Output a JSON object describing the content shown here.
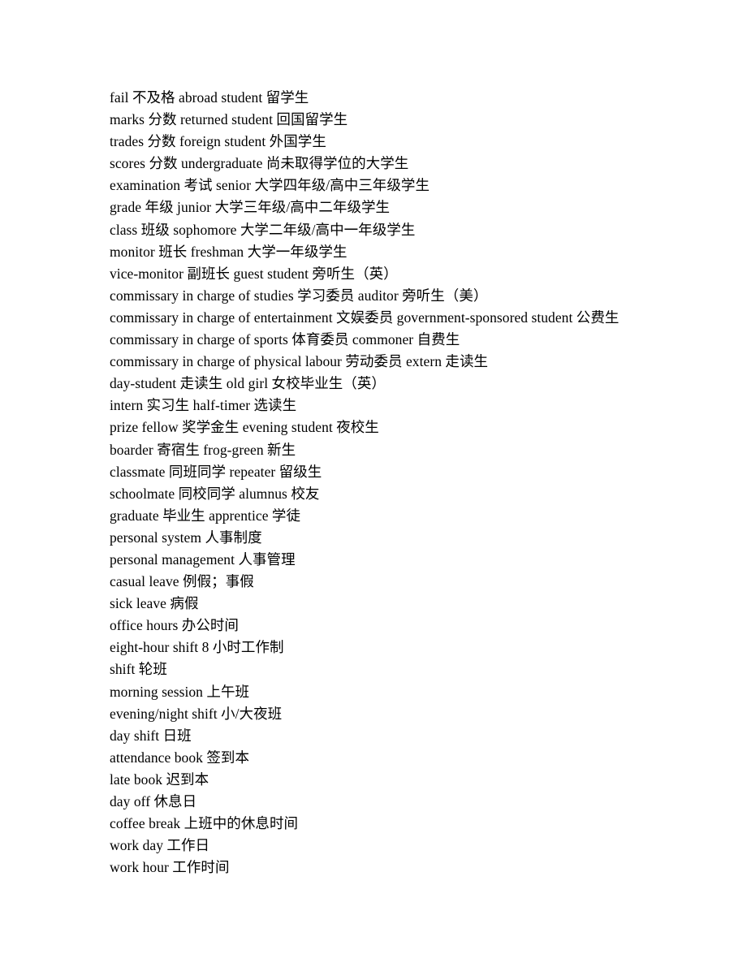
{
  "document": {
    "page_background": "#ffffff",
    "text_color": "#000000",
    "lines": [
      "fail 不及格 abroad student 留学生",
      "marks 分数 returned student 回国留学生",
      "trades 分数 foreign student 外国学生",
      "scores 分数 undergraduate 尚未取得学位的大学生",
      "examination 考试 senior 大学四年级/高中三年级学生",
      "grade 年级 junior 大学三年级/高中二年级学生",
      "class 班级 sophomore 大学二年级/高中一年级学生",
      "monitor 班长 freshman 大学一年级学生",
      "vice-monitor 副班长 guest student 旁听生（英）",
      "commissary in charge of studies 学习委员 auditor 旁听生（美）",
      "commissary in charge of entertainment 文娱委员 government-sponsored student 公费生",
      "commissary in charge of sports 体育委员 commoner 自费生",
      "commissary in charge of physical labour 劳动委员 extern 走读生",
      "day-student 走读生 old girl 女校毕业生（英）",
      "intern 实习生 half-timer 选读生",
      "prize fellow 奖学金生 evening student 夜校生",
      "boarder 寄宿生 frog-green 新生",
      "classmate 同班同学 repeater 留级生",
      "schoolmate 同校同学 alumnus 校友",
      "graduate 毕业生 apprentice 学徒",
      "personal system 人事制度",
      "personal management 人事管理",
      "casual leave 例假；事假",
      "sick leave 病假",
      "office hours 办公时间",
      "eight-hour shift 8 小时工作制",
      "shift 轮班",
      "morning session 上午班",
      "evening/night shift 小/大夜班",
      "day shift 日班",
      "attendance book 签到本",
      "late book 迟到本",
      "day off 休息日",
      "coffee break 上班中的休息时间",
      "work day 工作日",
      "work hour 工作时间"
    ]
  }
}
